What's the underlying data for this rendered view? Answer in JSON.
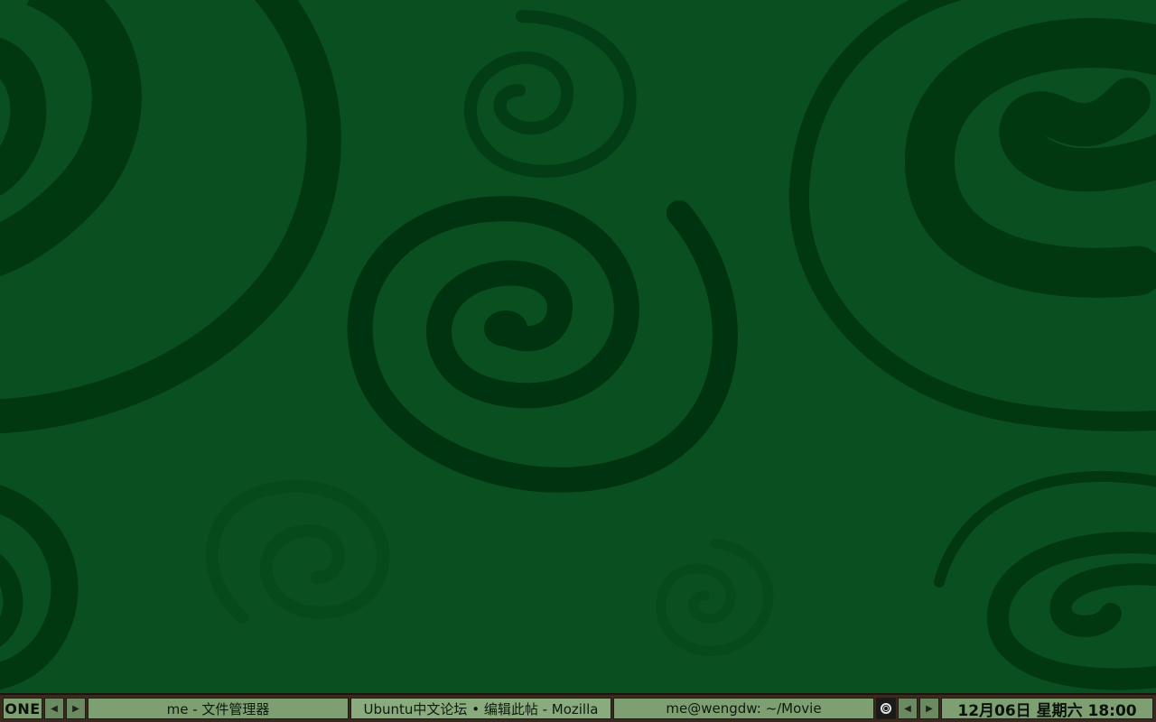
{
  "toolbar": {
    "workspace_label": "ONE",
    "prev_workspace_icon": "left-triangle-icon",
    "next_workspace_icon": "right-triangle-icon",
    "tasks": [
      {
        "title": "me - 文件管理器",
        "active": false
      },
      {
        "title": "Ubuntu中文论坛 • 编辑此帖 - Mozilla",
        "active": true
      },
      {
        "title": "me@wengdw: ~/Movie",
        "active": false
      }
    ],
    "tray_icon": "circle-app-icon",
    "prev_window_icon": "left-triangle-icon",
    "next_window_icon": "right-triangle-icon",
    "clock": "12月06日 星期六 18:00"
  },
  "colors": {
    "background": "#0a4f1f",
    "swirl_dark": "#00300f",
    "swirl_mid": "#033d15",
    "panel_green": "#7d9f72",
    "panel_border": "#3a2a1e"
  }
}
